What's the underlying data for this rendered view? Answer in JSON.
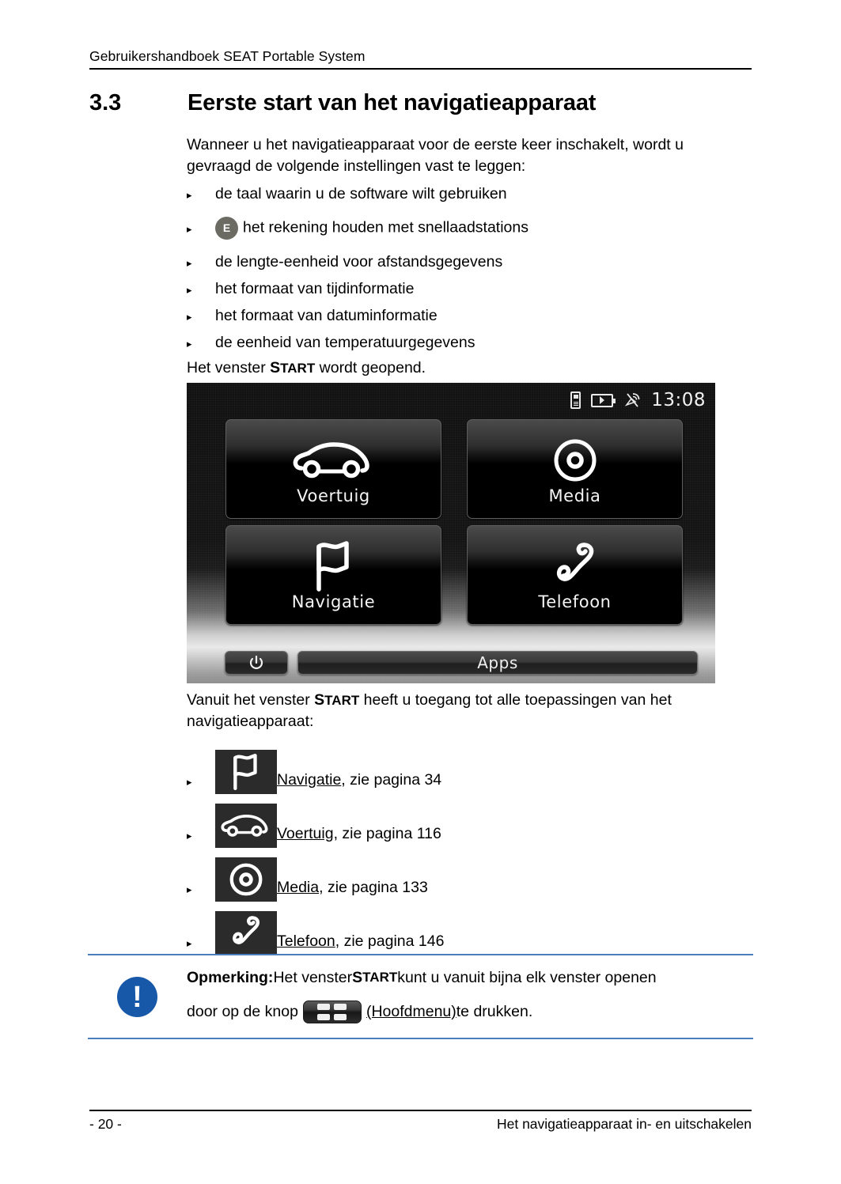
{
  "header": {
    "running_head": "Gebruikershandboek SEAT Portable System"
  },
  "section": {
    "number": "3.3",
    "title": "Eerste start van het navigatieapparaat"
  },
  "intro": {
    "paragraph": "Wanneer u het navigatieapparaat voor de eerste keer inschakelt, wordt u gevraagd de volgende instellingen vast te leggen:"
  },
  "settings_bullets": [
    {
      "marker": "▸",
      "text": "de taal waarin u de software wilt gebruiken",
      "badge": null
    },
    {
      "marker": "▸",
      "text": "het rekening houden met snellaadstations",
      "badge": "E"
    },
    {
      "marker": "▸",
      "text": "de lengte-eenheid voor afstandsgegevens",
      "badge": null
    },
    {
      "marker": "▸",
      "text": "het formaat van tijdinformatie",
      "badge": null
    },
    {
      "marker": "▸",
      "text": "het formaat van datuminformatie",
      "badge": null
    },
    {
      "marker": "▸",
      "text": "de eenheid van temperatuurgegevens",
      "badge": null
    }
  ],
  "after_bullets": {
    "pre": "Het venster ",
    "sc_first": "S",
    "sc_rest": "TART",
    "post": " wordt geopend."
  },
  "device": {
    "statusbar": {
      "phone_icon": "phone-icon",
      "battery_icon": "battery-charging-icon",
      "satellite_icon": "satellite-no-signal-icon",
      "time": "13:08"
    },
    "tiles": [
      {
        "label": "Voertuig",
        "icon": "car-icon"
      },
      {
        "label": "Media",
        "icon": "disc-icon"
      },
      {
        "label": "Navigatie",
        "icon": "flag-icon"
      },
      {
        "label": "Telefoon",
        "icon": "handset-icon"
      }
    ],
    "bottom": {
      "power_icon": "power-icon",
      "apps_label": "Apps"
    }
  },
  "access_paragraph": {
    "pre": "Vanuit het venster ",
    "sc_first": "S",
    "sc_rest": "TART",
    "post": " heeft u toegang tot alle toepassingen van het navigatieapparaat:"
  },
  "references": [
    {
      "marker": "▸",
      "icon": "flag-icon",
      "link": "Navigatie",
      "rest": ", zie pagina 34"
    },
    {
      "marker": "▸",
      "icon": "car-icon",
      "link": "Voertuig",
      "rest": ", zie pagina 116"
    },
    {
      "marker": "▸",
      "icon": "disc-icon",
      "link": "Media",
      "rest": ", zie pagina 133"
    },
    {
      "marker": "▸",
      "icon": "handset-icon",
      "link": "Telefoon",
      "rest": ", zie pagina 146"
    }
  ],
  "note": {
    "icon": "info-exclamation-icon",
    "label": "Opmerking:",
    "line1_pre": " Het venster ",
    "sc_first": "S",
    "sc_rest": "TART",
    "line1_post": " kunt u vanuit bijna elk venster openen",
    "line2_pre": "door op de knop",
    "button_icon": "main-menu-icon",
    "line2_link": "(Hoofdmenu)",
    "line2_post": " te drukken."
  },
  "footer": {
    "page_number": "- 20 -",
    "chapter": "Het navigatieapparaat in- en uitschakelen"
  },
  "colors": {
    "note_rule": "#4a7ebb",
    "note_icon": "#1858a8",
    "badge_gray": "#6b6b63",
    "tile_black": "#000000"
  }
}
